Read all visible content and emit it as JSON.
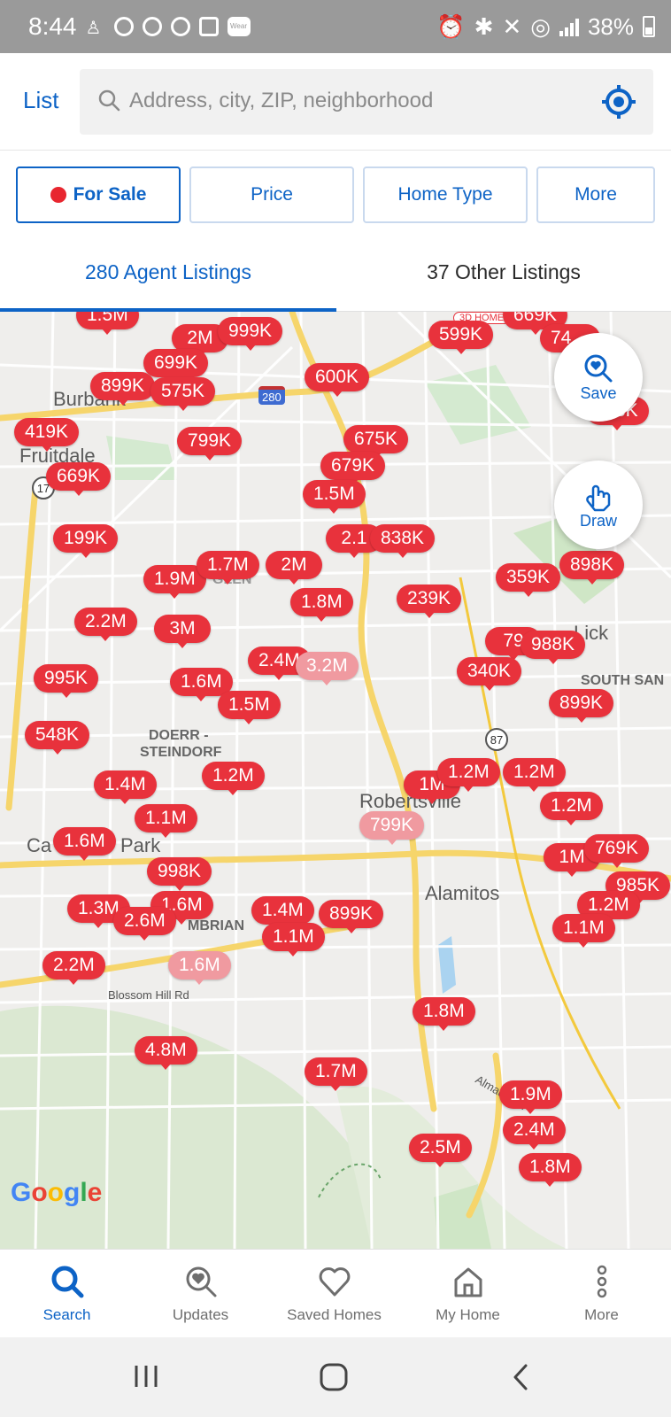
{
  "status_bar": {
    "time": "8:44",
    "battery": "38%",
    "wear_label": "Wear"
  },
  "header": {
    "list_label": "List",
    "search_placeholder": "Address, city, ZIP, neighborhood"
  },
  "filters": {
    "for_sale": "For Sale",
    "price": "Price",
    "home_type": "Home Type",
    "more": "More"
  },
  "tabs": {
    "agent": "280 Agent Listings",
    "other": "37 Other Listings"
  },
  "map": {
    "labels": {
      "burbank": "Burbank",
      "fruitdale": "Fruitdale",
      "doerr": "DOERR -",
      "steindorf": "STEINDORF",
      "robertsville": "Robertsville",
      "alamitos": "Alamitos",
      "campbell_a": "Ca",
      "campbell_b": "Park",
      "mbrian": "MBRIAN",
      "lick": "Lick",
      "south_san": "SOUTH SAN",
      "blossom": "Blossom Hill Rd",
      "almaden": "Almaden E",
      "glen": "GLEN"
    },
    "shields": {
      "i280": "280",
      "ca17": "17",
      "ca87": "87"
    },
    "badge_3d": "3D HOME",
    "pins": [
      "1.5M",
      "2M",
      "999K",
      "599K",
      "669K",
      "74…",
      "699K",
      "899K",
      "575K",
      "600K",
      "419K",
      "799K",
      "675K",
      "679K",
      "669K",
      "1.5M",
      "199K",
      "2.1",
      "838K",
      "1.9M",
      "1.7M",
      "2M",
      "359K",
      "898K",
      "1.8M",
      "239K",
      "2.2M",
      "3M",
      "79",
      "988K",
      "2.4M",
      "3.2M",
      "340K",
      "995K",
      "1.6M",
      "1.5M",
      "899K",
      "548K",
      "1.2M",
      "1.4M",
      "1M",
      "1.2M",
      "1.2M",
      "1.2M",
      "1.1M",
      "799K",
      "1.6M",
      "1M",
      "769K",
      "998K",
      "985K",
      "1.3M",
      "1.6M",
      "2.6M",
      "1.4M",
      "899K",
      "1.2M",
      "1.1M",
      "1.1M",
      "2.2M",
      "1.6M",
      "1.8M",
      "4.8M",
      "1.7M",
      "1.9M",
      "2.4M",
      "2.5M",
      "1.8M",
      "…8K"
    ],
    "fab_save": "Save",
    "fab_draw": "Draw",
    "google": [
      "G",
      "o",
      "o",
      "g",
      "l",
      "e"
    ]
  },
  "colors": {
    "accent": "#0d63c6",
    "pin": "#e8323c",
    "pin_seen": "#f09aa0"
  },
  "bottom_nav": {
    "search": "Search",
    "updates": "Updates",
    "saved": "Saved Homes",
    "my_home": "My Home",
    "more": "More"
  }
}
